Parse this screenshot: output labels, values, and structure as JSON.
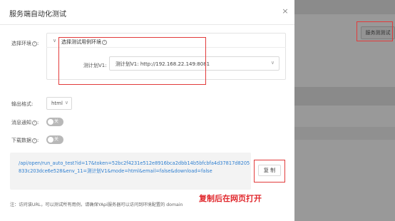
{
  "background": {
    "button_label": "服务测测试"
  },
  "modal": {
    "title": "服务端自动化测试",
    "close_glyph": "×"
  },
  "env": {
    "label": "选择环境",
    "help_glyph": "?",
    "panel_header": "选择测试用例环境",
    "item_label": "测计划V1:",
    "select_value": "测计划V1: http://192.168.22.149:8081",
    "chevron_glyph": "∨",
    "select_arrow": "∨"
  },
  "format": {
    "label": "输出格式:",
    "value": "html",
    "arrow": "∨"
  },
  "notify": {
    "label": "消息通知",
    "toggle_text": "关"
  },
  "download": {
    "label": "下载数据",
    "toggle_text": "关"
  },
  "url": {
    "text": "/api/open/run_auto_test?id=17&token=52bc2f4231e512e8916bca2dbb14b5bfcbfa4d37817d8205833c203dce6e528&env_11=测计划V1&mode=html&email=false&download=false"
  },
  "copy_button": {
    "label": "复 制"
  },
  "note": {
    "text": "注：访问该URL，可以测试所有用例，请确保YApi服务器可以访问到环境配置的 domain"
  },
  "annotation": {
    "text": "复制后在网页打开",
    "color": "#e0262b"
  },
  "colors": {
    "link": "#2f7fd0",
    "toggle_off": "#b8b8b8",
    "annotation_box": "#e23b3b"
  }
}
